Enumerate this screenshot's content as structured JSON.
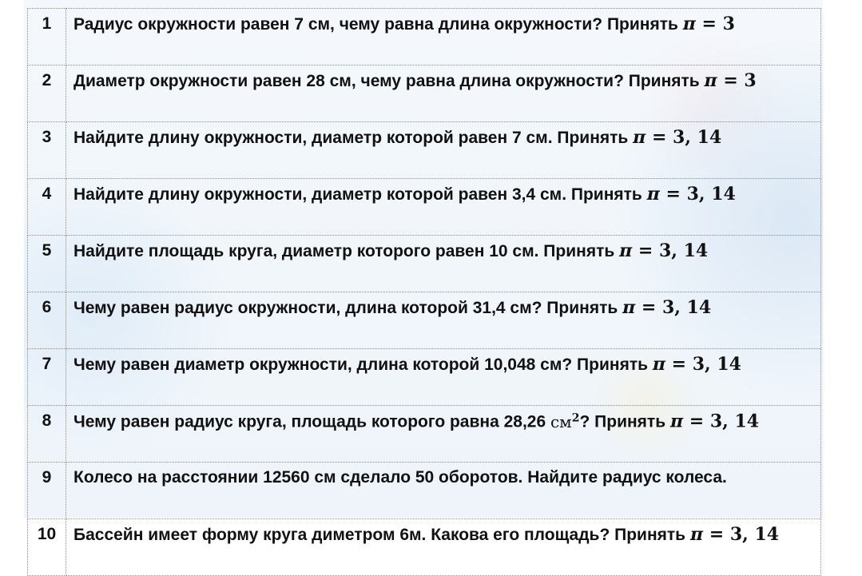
{
  "rows": [
    {
      "num": "1",
      "text": "Радиус окружности равен 7 см, чему равна длина окружности? Принять ",
      "pi_value": "3"
    },
    {
      "num": "2",
      "text": "Диаметр окружности равен 28 см, чему равна длина окружности? Принять ",
      "pi_value": "3"
    },
    {
      "num": "3",
      "text": "Найдите длину окружности,  диаметр которой равен 7 см. Принять ",
      "pi_value": "3, 14"
    },
    {
      "num": "4",
      "text": "Найдите длину окружности,  диаметр которой равен 3,4 см.  Принять ",
      "pi_value": "3, 14"
    },
    {
      "num": "5",
      "text": "Найдите площадь круга,  диаметр которого равен 10 см. Принять ",
      "pi_value": "3, 14"
    },
    {
      "num": "6",
      "text": "Чему равен радиус окружности, длина которой 31,4 см? Принять ",
      "pi_value": "3, 14"
    },
    {
      "num": "7",
      "text": "Чему равен диаметр окружности, длина которой 10,048 см? Принять ",
      "pi_value": "3, 14"
    },
    {
      "num": "8",
      "text": "Чему равен радиус круга, площадь которого равна 28,26 ",
      "unit": "см",
      "unit_power": "2",
      "text_after": "? Принять ",
      "pi_value": "3, 14"
    },
    {
      "num": "9",
      "text": "Колесо на расстоянии 12560 см сделало 50 оборотов. Найдите радиус колеса."
    },
    {
      "num": "10",
      "text": "Бассейн имеет форму круга диметром 6м. Какова его площадь? Принять ",
      "pi_value": "3, 14"
    }
  ],
  "formula": {
    "pi_symbol": "π",
    "equals": " = "
  }
}
